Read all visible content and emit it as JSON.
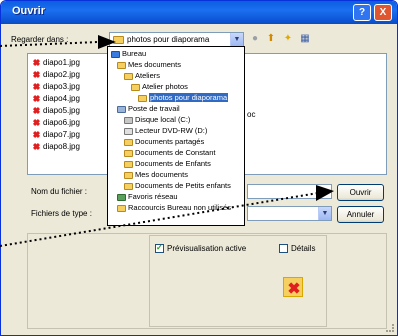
{
  "window": {
    "title": "Ouvrir",
    "help_label": "?",
    "close_label": "X"
  },
  "lookin": {
    "label": "Regarder dans :",
    "value": "photos pour diaporama"
  },
  "toolbar": {
    "icons": [
      "back-icon",
      "up-folder-icon",
      "new-folder-icon",
      "view-menu-icon"
    ]
  },
  "files": [
    "diapo1.jpg",
    "diapo2.jpg",
    "diapo3.jpg",
    "diapo4.jpg",
    "diapo5.jpg",
    "diapo6.jpg",
    "diapo7.jpg",
    "diapo8.jpg"
  ],
  "dropdown": {
    "items": [
      {
        "label": "Bureau",
        "icon": "desktop-icon"
      },
      {
        "label": "Mes documents",
        "icon": "documents-icon"
      },
      {
        "label": "Ateliers",
        "icon": "folder-icon"
      },
      {
        "label": "Atelier photos",
        "icon": "folder-icon"
      },
      {
        "label": "photos pour diaporama",
        "icon": "folder-open-icon",
        "selected": true
      },
      {
        "label": "Poste de travail",
        "icon": "computer-icon"
      },
      {
        "label": "Disque local (C:)",
        "icon": "disk-icon"
      },
      {
        "label": "Lecteur DVD-RW (D:)",
        "icon": "dvd-icon"
      },
      {
        "label": "Documents partagés",
        "icon": "folder-icon"
      },
      {
        "label": "Documents de Constant",
        "icon": "folder-icon"
      },
      {
        "label": "Documents de Enfants",
        "icon": "folder-icon"
      },
      {
        "label": "Mes documents",
        "icon": "folder-icon"
      },
      {
        "label": "Documents de Petits enfants",
        "icon": "folder-icon"
      },
      {
        "label": "Favoris réseau",
        "icon": "network-icon"
      },
      {
        "label": "Raccourcis Bureau non utilisés",
        "icon": "folder-icon"
      }
    ]
  },
  "partial_text": "oc",
  "form": {
    "name_label": "Nom du fichier :",
    "name_value": "",
    "type_label": "Fichiers de type :",
    "type_value": ""
  },
  "buttons": {
    "open": "Ouvrir",
    "cancel": "Annuler"
  },
  "preview": {
    "active_label": "Prévisualisation active",
    "active_checked": true,
    "details_label": "Détails",
    "details_checked": false
  }
}
